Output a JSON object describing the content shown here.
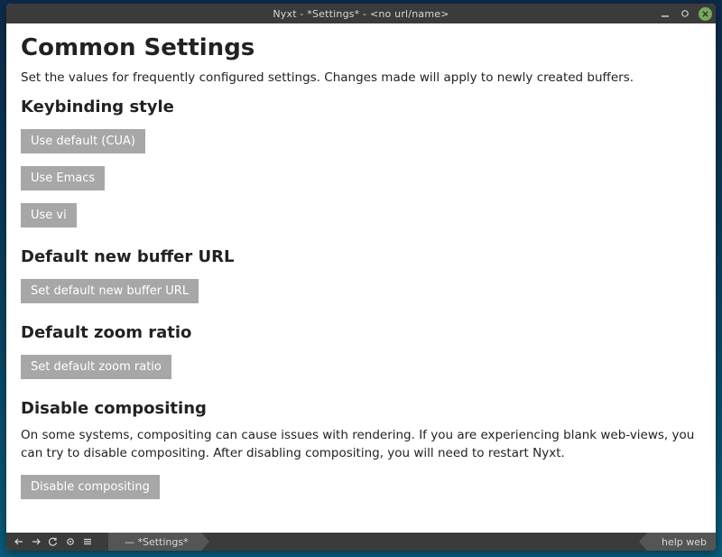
{
  "window": {
    "title": "Nyxt - *Settings* - <no url/name>"
  },
  "page": {
    "heading": "Common Settings",
    "intro": "Set the values for frequently configured settings. Changes made will apply to newly created buffers.",
    "sections": {
      "keybinding": {
        "title": "Keybinding style",
        "buttons": {
          "cua": "Use default (CUA)",
          "emacs": "Use Emacs",
          "vi": "Use vi"
        }
      },
      "new_buffer_url": {
        "title": "Default new buffer URL",
        "button": "Set default new buffer URL"
      },
      "zoom": {
        "title": "Default zoom ratio",
        "button": "Set default zoom ratio"
      },
      "compositing": {
        "title": "Disable compositing",
        "body": "On some systems, compositing can cause issues with rendering. If you are experiencing blank web-views, you can try to disable compositing. After disabling compositing, you will need to restart Nyxt.",
        "button": "Disable compositing"
      }
    }
  },
  "statusbar": {
    "buffer": "— *Settings*",
    "modes": "help web"
  }
}
